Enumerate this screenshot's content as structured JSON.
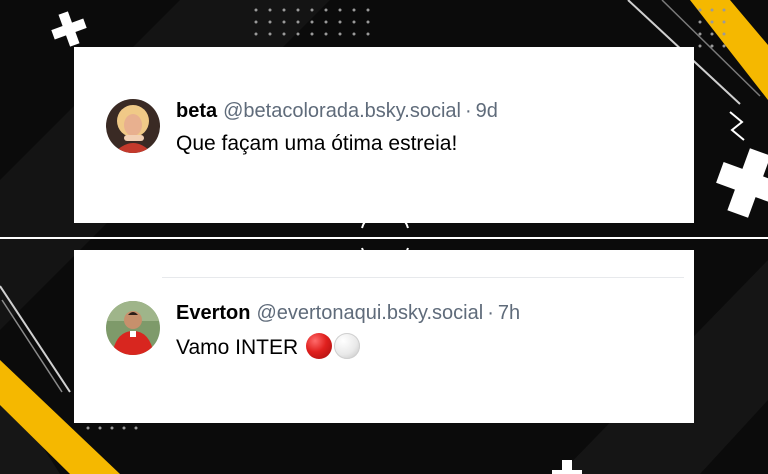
{
  "posts": [
    {
      "display_name": "beta",
      "handle": "@betacolorada.bsky.social",
      "separator": "·",
      "age": "9d",
      "text": "Que façam uma ótima estreia!",
      "avatar_icon": "avatar-photo"
    },
    {
      "display_name": "Everton",
      "handle": "@evertonaqui.bsky.social",
      "separator": "·",
      "age": "7h",
      "text": "Vamo INTER",
      "emojis": [
        "red-circle-emoji",
        "white-circle-emoji"
      ],
      "avatar_icon": "avatar-photo"
    }
  ],
  "colors": {
    "background": "#0b0b0b",
    "accent_yellow": "#f5b800",
    "card": "#ffffff",
    "handle_gray": "#5f6b7a"
  }
}
